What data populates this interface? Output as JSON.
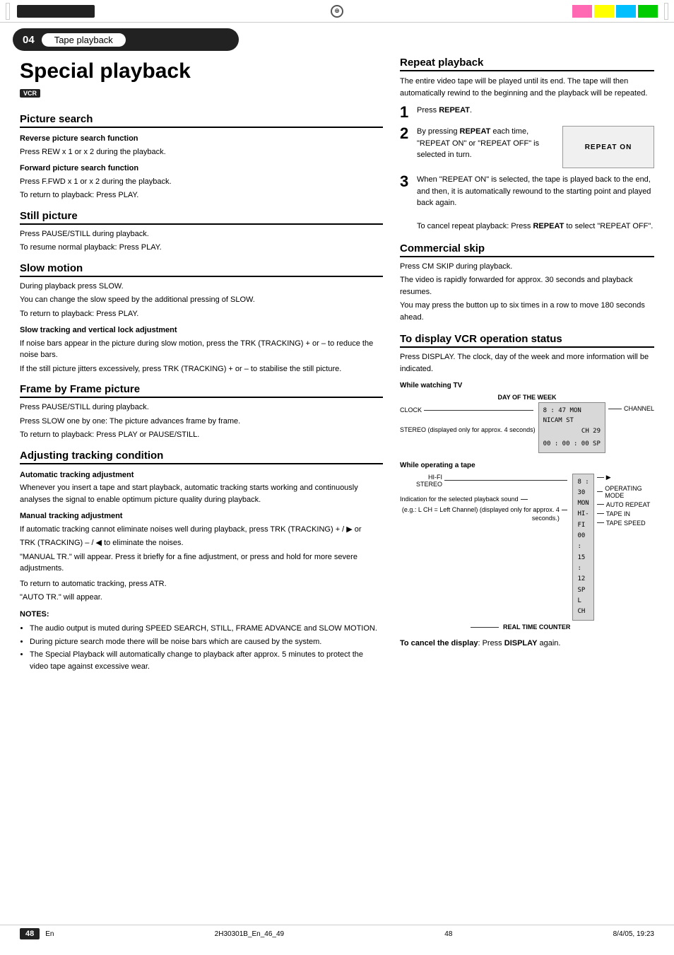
{
  "page": {
    "section_number": "04",
    "section_title": "Tape playback",
    "page_title": "Special playback",
    "vcr_badge": "VCR",
    "footer_left": "2H30301B_En_46_49",
    "footer_center": "48",
    "footer_right": "8/4/05, 19:23",
    "footer_lang": "En"
  },
  "left": {
    "picture_search": {
      "heading": "Picture search",
      "reverse_sub": "Reverse picture search function",
      "reverse_text": "Press REW x 1 or x 2 during the playback.",
      "forward_sub": "Forward picture search function",
      "forward_text1": "Press F.FWD x 1 or x 2 during the playback.",
      "forward_text2": "To return to playback: Press PLAY."
    },
    "still_picture": {
      "heading": "Still picture",
      "text1": "Press PAUSE/STILL during playback.",
      "text2": "To resume normal playback: Press PLAY."
    },
    "slow_motion": {
      "heading": "Slow motion",
      "text1": "During playback press SLOW.",
      "text2": "You can change the slow speed by the additional pressing of SLOW.",
      "text3": "To return to playback: Press PLAY.",
      "tracking_sub": "Slow tracking and vertical lock adjustment",
      "tracking_text1": "If noise bars appear in the picture during slow motion, press the TRK (TRACKING) + or – to reduce the noise bars.",
      "tracking_text2": "If the still picture jitters excessively, press TRK (TRACKING) + or – to stabilise the still picture."
    },
    "frame_by_frame": {
      "heading": "Frame by Frame picture",
      "text1": "Press PAUSE/STILL during playback.",
      "text2": "Press SLOW one by one: The picture advances frame by frame.",
      "text3": "To return to playback: Press PLAY or PAUSE/STILL."
    },
    "adjusting_tracking": {
      "heading": "Adjusting tracking condition",
      "auto_sub": "Automatic tracking adjustment",
      "auto_text": "Whenever you insert a tape and start playback, automatic tracking starts working and continuously analyses the signal to enable optimum picture quality during playback.",
      "manual_sub": "Manual tracking adjustment",
      "manual_text1": "If automatic tracking cannot eliminate noises well during playback, press TRK (TRACKING) + / ▶ or",
      "manual_text2": "TRK (TRACKING) – / ◀ to eliminate the noises.",
      "manual_text3": "\"MANUAL TR.\" will appear. Press it briefly for a fine adjustment, or press and hold for more severe adjustments.",
      "manual_text4": "To return to automatic tracking, press ATR.",
      "manual_text5": "\"AUTO TR.\" will appear.",
      "notes_heading": "NOTES:",
      "notes": [
        "The audio output is muted during SPEED SEARCH, STILL, FRAME ADVANCE and SLOW MOTION.",
        "During picture search mode there will be noise bars which are caused by the system.",
        "The Special Playback will automatically change to playback after approx. 5 minutes to protect the video tape against excessive wear."
      ]
    }
  },
  "right": {
    "repeat_playback": {
      "heading": "Repeat playback",
      "intro": "The entire video tape will be played until its end. The tape will then automatically rewind to the beginning and the playback will be repeated.",
      "step1_num": "1",
      "step1_text": "Press REPEAT.",
      "step2_num": "2",
      "step2_text1": "By pressing REPEAT each time, \"REPEAT ON\" or \"REPEAT OFF\" is selected in turn.",
      "repeat_on_label": "REPEAT ON",
      "step3_num": "3",
      "step3_text1": "When \"REPEAT ON\" is selected, the tape is played back to the end, and then, it is automatically rewound to the starting point and played back again.",
      "step3_text2": "To cancel repeat playback: Press REPEAT to select \"REPEAT OFF\"."
    },
    "commercial_skip": {
      "heading": "Commercial skip",
      "text1": "Press CM SKIP during playback.",
      "text2": "The video is rapidly forwarded for approx. 30 seconds and playback resumes.",
      "text3": "You may press the button up to six times in a row to move 180 seconds ahead."
    },
    "vcr_status": {
      "heading": "To display VCR operation status",
      "text1": "Press DISPLAY. The clock, day of the week and more information will be indicated.",
      "watching_tv_label": "While watching TV",
      "tv_diagram": {
        "day_label": "DAY OF THE WEEK",
        "clock_label": "CLOCK",
        "channel_label": "CHANNEL",
        "stereo_label": "STEREO (displayed only for approx. 4 seconds)",
        "screen_line1": "8 : 47  MON",
        "screen_line2": "NICAM ST",
        "screen_line3": "CH 29",
        "screen_line4": "00 : 00 : 00 SP"
      },
      "operating_tape_label": "While operating a tape",
      "tape_diagram": {
        "hifi_label": "HI-FI",
        "stereo_label": "STEREO",
        "indication_label": "Indication for the selected playback sound",
        "eg_label": "(e.g.: L CH = Left Channel) (displayed only for approx. 4 seconds.)",
        "screen_line1": "8 : 30  MON",
        "screen_line2": "HI-FI",
        "screen_line3": "00 : 15 : 12 SP",
        "screen_line4": "L CH",
        "play_icon": "▶",
        "operating_mode_label": "OPERATING MODE",
        "auto_repeat_label": "AUTO REPEAT",
        "tape_in_label": "TAPE IN",
        "tape_speed_label": "TAPE SPEED",
        "real_time_label": "REAL TIME COUNTER"
      },
      "cancel_text": "To cancel the display: Press DISPLAY again."
    }
  }
}
